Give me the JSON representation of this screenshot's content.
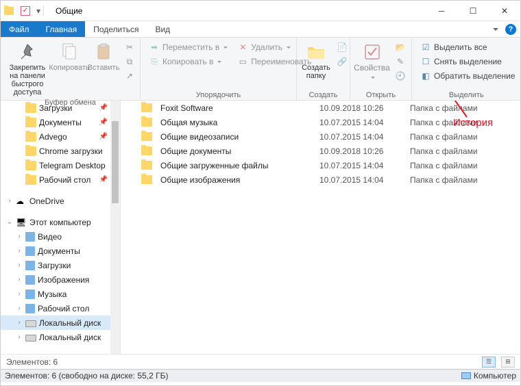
{
  "window": {
    "title": "Общие"
  },
  "menu": {
    "file": "Файл",
    "home": "Главная",
    "share": "Поделиться",
    "view": "Вид"
  },
  "ribbon": {
    "clipboard": {
      "label": "Буфер обмена",
      "pin": "Закрепить на панели\nбыстрого доступа",
      "copy": "Копировать",
      "paste": "Вставить"
    },
    "organize": {
      "label": "Упорядочить",
      "moveTo": "Переместить в",
      "delete": "Удалить",
      "copyTo": "Копировать в",
      "rename": "Переименовать"
    },
    "create": {
      "label": "Создать",
      "newFolder": "Создать\nпапку"
    },
    "open": {
      "label": "Открыть",
      "properties": "Свойства"
    },
    "select": {
      "label": "Выделить",
      "selectAll": "Выделить все",
      "selectNone": "Снять выделение",
      "invert": "Обратить выделение"
    }
  },
  "tree": {
    "items": [
      {
        "t": "Загрузки",
        "icon": "folder",
        "pin": true,
        "indent": 1
      },
      {
        "t": "Документы",
        "icon": "folder",
        "pin": true,
        "indent": 1
      },
      {
        "t": "Advego",
        "icon": "folder",
        "pin": true,
        "indent": 1
      },
      {
        "t": "Chrome загрузки",
        "icon": "folder",
        "indent": 1
      },
      {
        "t": "Telegram Desktop",
        "icon": "folder",
        "indent": 1
      },
      {
        "t": "Рабочий стол",
        "icon": "folder",
        "pin": true,
        "indent": 1
      },
      {
        "t": "",
        "spacer": true
      },
      {
        "t": "OneDrive",
        "icon": "onedrive",
        "exp": "›",
        "indent": 0
      },
      {
        "t": "",
        "spacer": true
      },
      {
        "t": "Этот компьютер",
        "icon": "pc",
        "exp": "⌄",
        "indent": 0
      },
      {
        "t": "Видео",
        "icon": "lib",
        "exp": "›",
        "indent": 1
      },
      {
        "t": "Документы",
        "icon": "lib",
        "exp": "›",
        "indent": 1
      },
      {
        "t": "Загрузки",
        "icon": "lib",
        "exp": "›",
        "indent": 1
      },
      {
        "t": "Изображения",
        "icon": "lib",
        "exp": "›",
        "indent": 1
      },
      {
        "t": "Музыка",
        "icon": "lib",
        "exp": "›",
        "indent": 1
      },
      {
        "t": "Рабочий стол",
        "icon": "lib",
        "exp": "›",
        "indent": 1
      },
      {
        "t": "Локальный диск",
        "icon": "drive",
        "exp": "›",
        "indent": 1,
        "sel": true
      },
      {
        "t": "Локальный диск",
        "icon": "drive",
        "exp": "›",
        "indent": 1
      }
    ]
  },
  "list": {
    "rows": [
      {
        "name": "Foxit Software",
        "date": "10.09.2018 10:26",
        "type": "Папка с файлами"
      },
      {
        "name": "Общая музыка",
        "date": "10.07.2015 14:04",
        "type": "Папка с файлами"
      },
      {
        "name": "Общие видеозаписи",
        "date": "10.07.2015 14:04",
        "type": "Папка с файлами"
      },
      {
        "name": "Общие документы",
        "date": "10.09.2018 10:26",
        "type": "Папка с файлами"
      },
      {
        "name": "Общие загруженные файлы",
        "date": "10.07.2015 14:04",
        "type": "Папка с файлами"
      },
      {
        "name": "Общие изображения",
        "date": "10.07.2015 14:04",
        "type": "Папка с файлами"
      }
    ]
  },
  "status": {
    "count": "Элементов: 6"
  },
  "footer": {
    "left": "Элементов: 6 (свободно на диске: 55,2 ГБ)",
    "right": "Компьютер"
  },
  "annotation": "История"
}
